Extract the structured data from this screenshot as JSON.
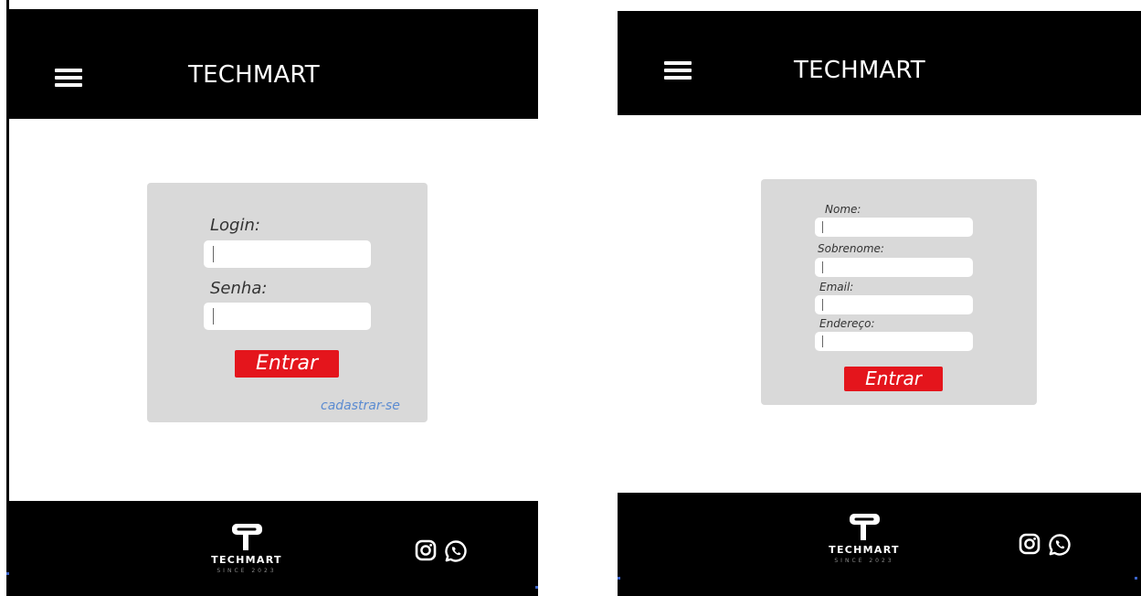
{
  "brand": "TECHMART",
  "login_screen": {
    "login_label": "Login:",
    "password_label": "Senha:",
    "submit_label": "Entrar",
    "register_link": "cadastrar-se"
  },
  "register_screen": {
    "fields": [
      {
        "label": "Nome:"
      },
      {
        "label": "Sobrenome:"
      },
      {
        "label": "Email:"
      },
      {
        "label": "Endereço:"
      }
    ],
    "submit_label": "Entrar"
  },
  "footer": {
    "logo_text": "TECHMART",
    "logo_tagline": "SINCE 2023",
    "social_icons": [
      "instagram-icon",
      "whatsapp-icon"
    ]
  },
  "colors": {
    "header_bg": "#000000",
    "card_bg": "#d9d9d9",
    "button_bg": "#e4151c",
    "link": "#5b8bd1"
  }
}
